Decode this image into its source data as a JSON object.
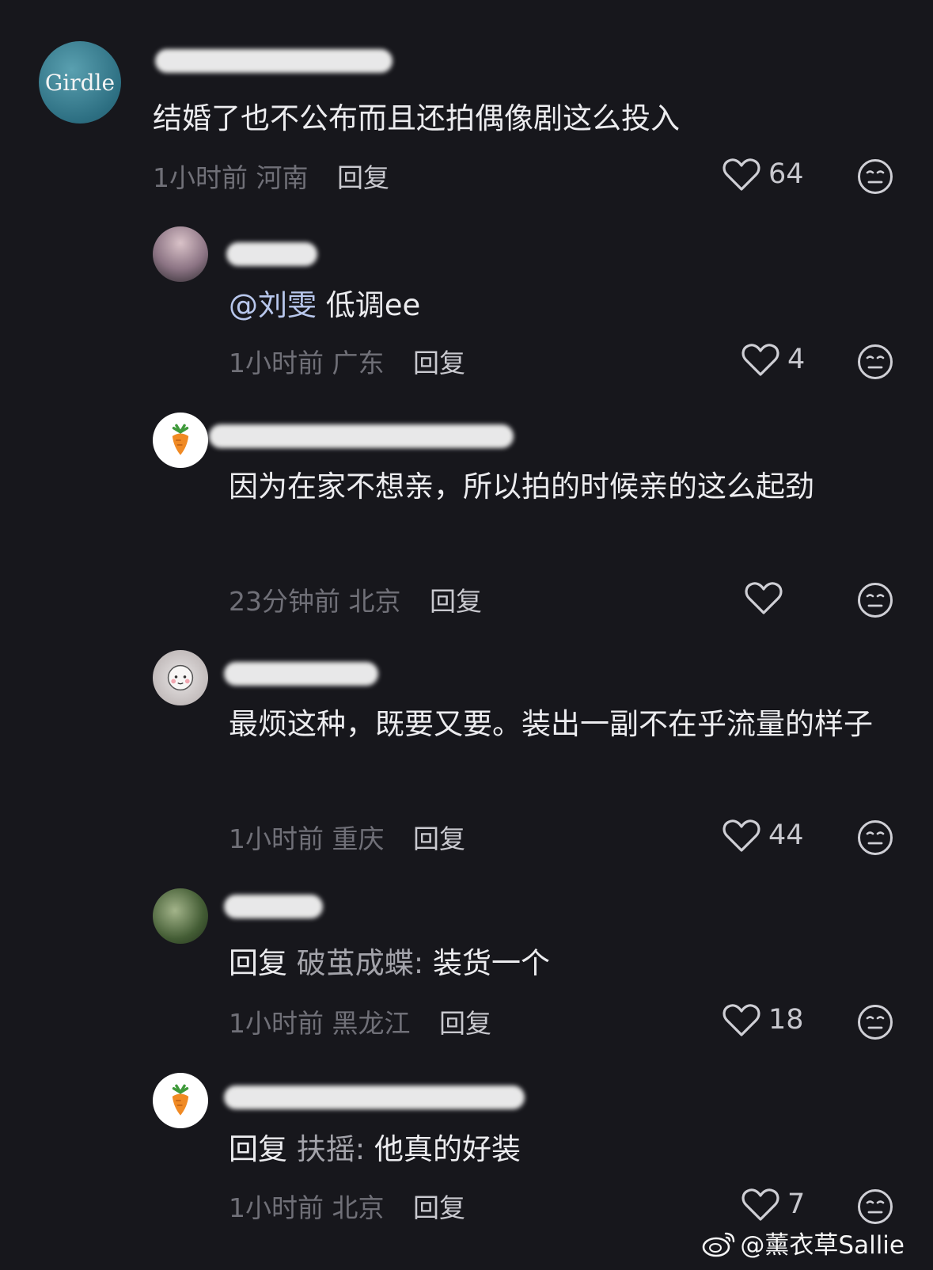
{
  "comments": [
    {
      "text": "结婚了也不公布而且还拍偶像剧这么投入",
      "time": "1小时前",
      "location": "河南",
      "reply_label": "回复",
      "likes": "64",
      "avatar_text": "Girdle"
    },
    {
      "mention": "@刘雯",
      "text": " 低调ee",
      "time": "1小时前",
      "location": "广东",
      "reply_label": "回复",
      "likes": "4"
    },
    {
      "text": "因为在家不想亲，所以拍的时候亲的这么起劲",
      "time": "23分钟前",
      "location": "北京",
      "reply_label": "回复",
      "likes": ""
    },
    {
      "text": "最烦这种，既要又要。装出一副不在乎流量的样子",
      "time": "1小时前",
      "location": "重庆",
      "reply_label": "回复",
      "likes": "44"
    },
    {
      "reply_prefix": "回复",
      "reply_to": "破茧成蝶:",
      "text": " 装货一个",
      "time": "1小时前",
      "location": "黑龙江",
      "reply_label": "回复",
      "likes": "18"
    },
    {
      "reply_prefix": "回复",
      "reply_to": "扶摇:",
      "text": " 他真的好装",
      "time": "1小时前",
      "location": "北京",
      "reply_label": "回复",
      "likes": "7"
    }
  ],
  "watermark": "@薰衣草Sallie",
  "icons": {
    "like": "heart-outline-icon",
    "reaction": "neutral-face-icon",
    "watermark": "weibo-logo-icon",
    "carrot": "carrot-icon"
  }
}
